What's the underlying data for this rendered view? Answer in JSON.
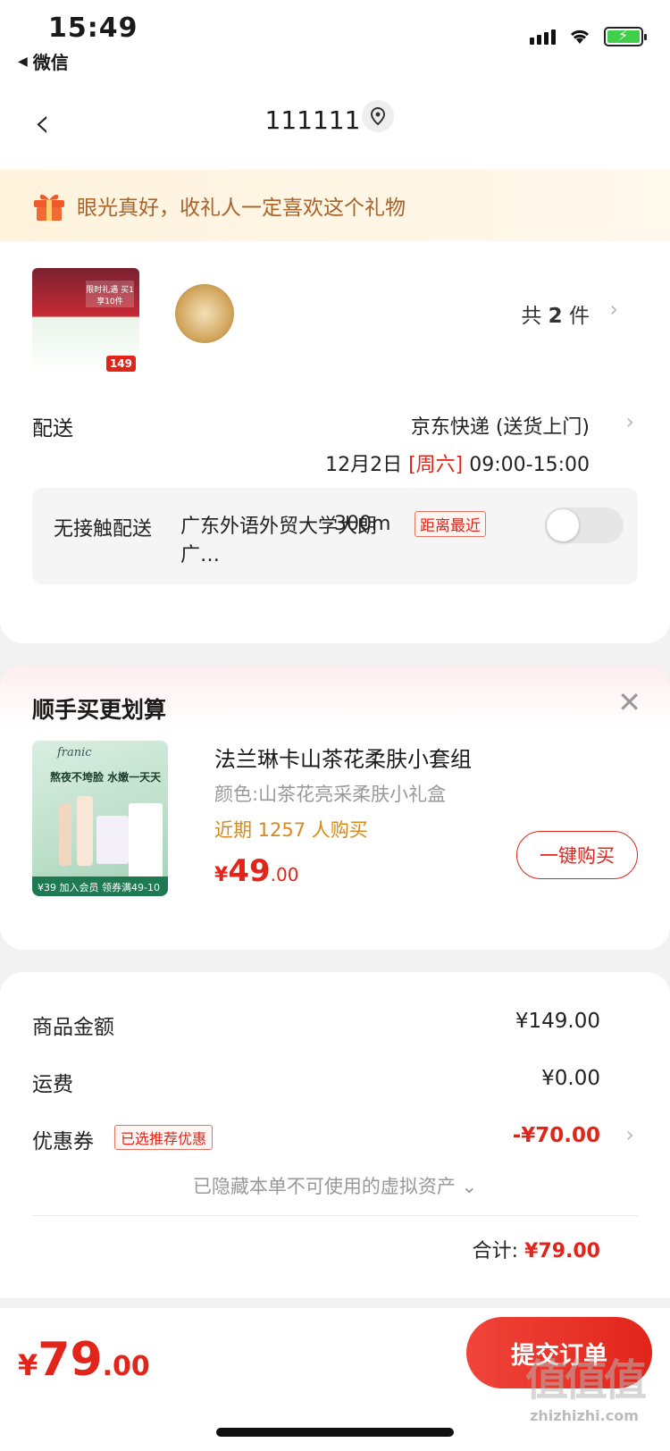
{
  "status_bar": {
    "time": "15:49",
    "back_app": "微信"
  },
  "nav": {
    "title": "111111"
  },
  "gift_banner": {
    "text": "眼光真好，收礼人一定喜欢这个礼物"
  },
  "order": {
    "thumb_labels": {
      "top": "限时礼遇 买1享10件",
      "price": "149"
    },
    "count_prefix": "共",
    "count_value": "2",
    "count_suffix": "件",
    "delivery": {
      "label": "配送",
      "method": "京东快递 (送货上门)",
      "date": "12月2日",
      "weekday": "[周六]",
      "time": "09:00-15:00"
    },
    "contactless": {
      "label": "无接触配送",
      "address": "广东外语外贸大学大朗广…",
      "distance": "300m",
      "tag": "距离最近",
      "enabled": false
    }
  },
  "upsell": {
    "title": "顺手买更划算",
    "thumb": {
      "brand": "franic",
      "slogan": "熬夜不垮脸 水嫩一天天",
      "footer": "¥39 加入会员 领券满49-10"
    },
    "name": "法兰琳卡山茶花柔肤小套组",
    "variant": "颜色:山茶花亮采柔肤小礼盒",
    "recent": "近期 1257 人购买",
    "price_currency": "¥",
    "price_int": "49",
    "price_dec": ".00",
    "buy_label": "一键购买"
  },
  "summary": {
    "goods_label": "商品金额",
    "goods_value": "¥149.00",
    "shipping_label": "运费",
    "shipping_value": "¥0.00",
    "coupon_label": "优惠券",
    "coupon_tag": "已选推荐优惠",
    "coupon_value": "-¥70.00",
    "hidden_note": "已隐藏本单不可使用的虚拟资产",
    "total_label": "合计:",
    "total_value": "¥79.00"
  },
  "bottom_bar": {
    "price_currency": "¥",
    "price_int": "79",
    "price_dec": ".00",
    "submit_label": "提交订单"
  },
  "watermark": {
    "logo": "值值值",
    "site": "zhizhizhi.com"
  },
  "colors": {
    "accent": "#e1251b",
    "warn": "#d8891b",
    "banner_text": "#a8622a"
  }
}
